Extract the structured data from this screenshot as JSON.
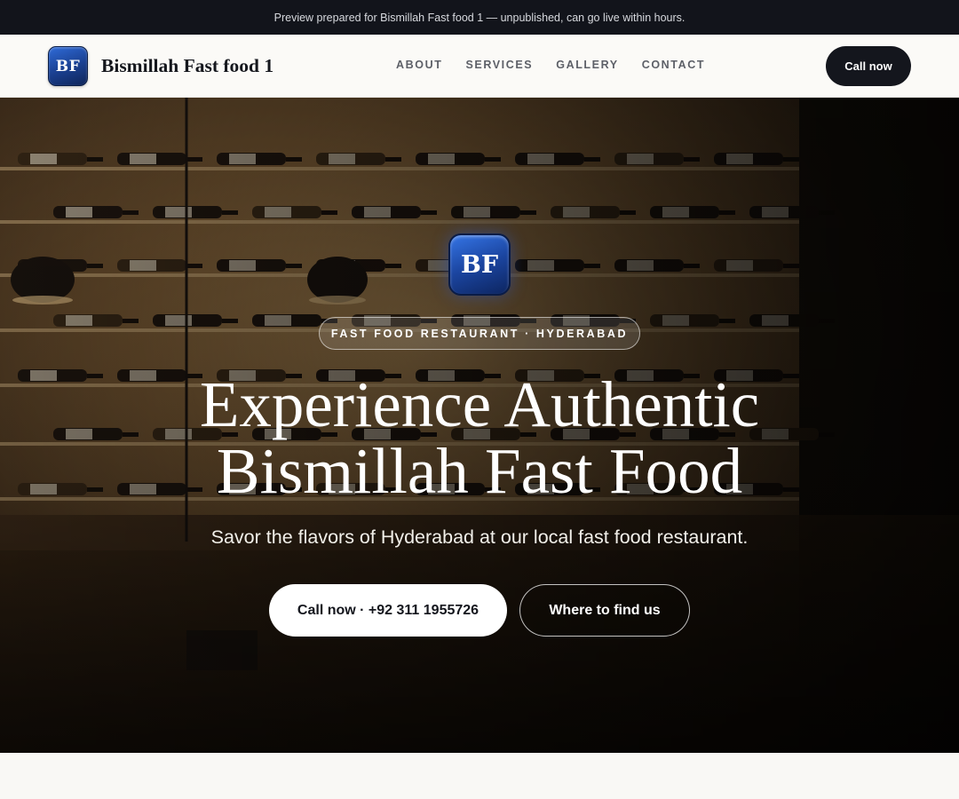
{
  "preview_banner": {
    "text": "Preview prepared for Bismillah Fast food 1 — unpublished, can go live within hours."
  },
  "header": {
    "logo_initials": "BF",
    "brand_name": "Bismillah Fast food 1",
    "nav": [
      {
        "label": "ABOUT"
      },
      {
        "label": "SERVICES"
      },
      {
        "label": "GALLERY"
      },
      {
        "label": "CONTACT"
      }
    ],
    "cta_label": "Call now"
  },
  "hero": {
    "logo_initials": "BF",
    "tagline": "FAST FOOD RESTAURANT · HYDERABAD",
    "title_line_1": "Experience Authentic",
    "title_line_2": "Bismillah Fast Food",
    "subtitle": "Savor the flavors of Hyderabad at our local fast food restaurant.",
    "primary_button": "Call now · +92 311 1955726",
    "secondary_button": "Where to find us"
  },
  "colors": {
    "dark": "#12141b",
    "logo_blue": "#1b45a0",
    "page_bg": "#f9f8f5"
  }
}
